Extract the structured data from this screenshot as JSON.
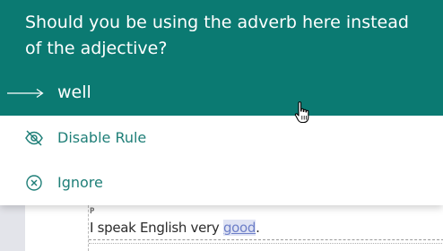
{
  "popup": {
    "message": "Should you be using the adverb here instead of the adjective?",
    "suggestion": "well",
    "actions": {
      "disable_rule": "Disable Rule",
      "ignore": "Ignore"
    }
  },
  "editor": {
    "paragraph_tag": "P",
    "text_before": "I speak English very ",
    "flagged_word": "good",
    "text_after": "."
  },
  "colors": {
    "header_bg": "#0b7a72",
    "action_text": "#1f7f78",
    "flag_highlight": "#dfe3f4"
  }
}
